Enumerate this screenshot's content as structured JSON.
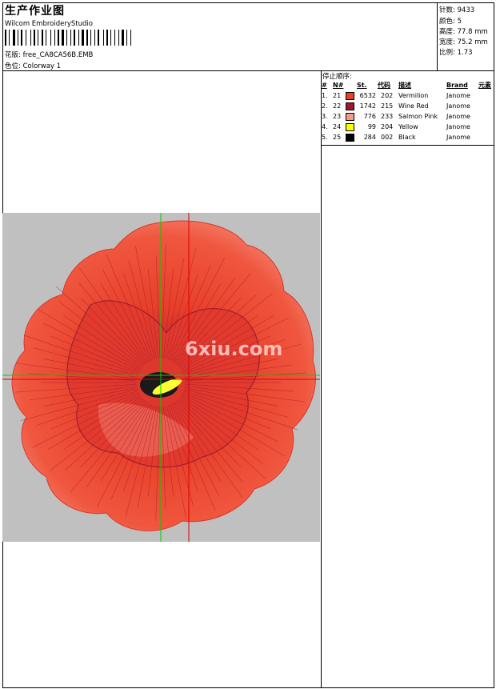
{
  "header": {
    "title": "生产作业图",
    "software": "Wilcom EmbroideryStudio",
    "design_label": "花版:",
    "design_file": "free_CA8CA56B.EMB",
    "colorway_label": "色位:",
    "colorway": "Colorway 1"
  },
  "stats": [
    {
      "label": "针数:",
      "value": "9433"
    },
    {
      "label": "颜色:",
      "value": "5"
    },
    {
      "label": "高度:",
      "value": "77.8 mm"
    },
    {
      "label": "宽度:",
      "value": "75.2 mm"
    },
    {
      "label": "比例:",
      "value": "1.73"
    }
  ],
  "stop_sequence": {
    "label": "停止顺序:",
    "headers": [
      "#",
      "N#",
      "St.",
      "代码",
      "描述",
      "Brand",
      "元素"
    ],
    "rows": [
      {
        "num": "1.",
        "n": "21",
        "color": "#e8402a",
        "st": "6532",
        "code": "202",
        "desc": "Vermilion",
        "brand": "Janome"
      },
      {
        "num": "2.",
        "n": "22",
        "color": "#a0182e",
        "st": "1742",
        "code": "215",
        "desc": "Wine Red",
        "brand": "Janome"
      },
      {
        "num": "3.",
        "n": "23",
        "color": "#f49a8c",
        "st": "776",
        "code": "233",
        "desc": "Salmon Pink",
        "brand": "Janome"
      },
      {
        "num": "4.",
        "n": "24",
        "color": "#ffff00",
        "st": "99",
        "code": "204",
        "desc": "Yellow",
        "brand": "Janome"
      },
      {
        "num": "5.",
        "n": "25",
        "color": "#000000",
        "st": "284",
        "code": "002",
        "desc": "Black",
        "brand": "Janome"
      }
    ]
  },
  "preview": {
    "background": "#c0c0c0",
    "watermark": "6xiu.com"
  }
}
